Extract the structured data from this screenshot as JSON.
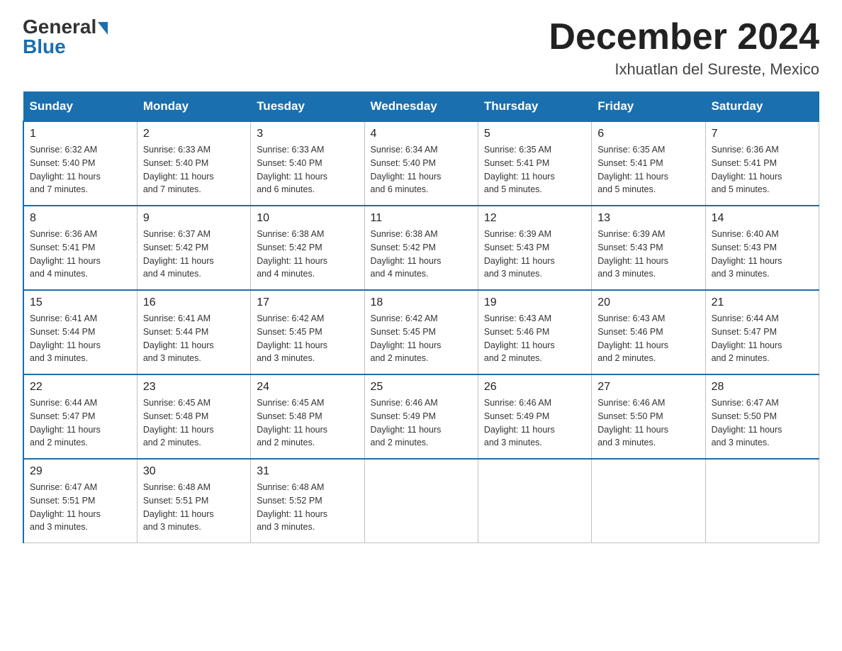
{
  "logo": {
    "general": "General",
    "blue": "Blue"
  },
  "header": {
    "title": "December 2024",
    "subtitle": "Ixhuatlan del Sureste, Mexico"
  },
  "days_of_week": [
    "Sunday",
    "Monday",
    "Tuesday",
    "Wednesday",
    "Thursday",
    "Friday",
    "Saturday"
  ],
  "weeks": [
    [
      {
        "day": "1",
        "sunrise": "6:32 AM",
        "sunset": "5:40 PM",
        "daylight": "11 hours and 7 minutes."
      },
      {
        "day": "2",
        "sunrise": "6:33 AM",
        "sunset": "5:40 PM",
        "daylight": "11 hours and 7 minutes."
      },
      {
        "day": "3",
        "sunrise": "6:33 AM",
        "sunset": "5:40 PM",
        "daylight": "11 hours and 6 minutes."
      },
      {
        "day": "4",
        "sunrise": "6:34 AM",
        "sunset": "5:40 PM",
        "daylight": "11 hours and 6 minutes."
      },
      {
        "day": "5",
        "sunrise": "6:35 AM",
        "sunset": "5:41 PM",
        "daylight": "11 hours and 5 minutes."
      },
      {
        "day": "6",
        "sunrise": "6:35 AM",
        "sunset": "5:41 PM",
        "daylight": "11 hours and 5 minutes."
      },
      {
        "day": "7",
        "sunrise": "6:36 AM",
        "sunset": "5:41 PM",
        "daylight": "11 hours and 5 minutes."
      }
    ],
    [
      {
        "day": "8",
        "sunrise": "6:36 AM",
        "sunset": "5:41 PM",
        "daylight": "11 hours and 4 minutes."
      },
      {
        "day": "9",
        "sunrise": "6:37 AM",
        "sunset": "5:42 PM",
        "daylight": "11 hours and 4 minutes."
      },
      {
        "day": "10",
        "sunrise": "6:38 AM",
        "sunset": "5:42 PM",
        "daylight": "11 hours and 4 minutes."
      },
      {
        "day": "11",
        "sunrise": "6:38 AM",
        "sunset": "5:42 PM",
        "daylight": "11 hours and 4 minutes."
      },
      {
        "day": "12",
        "sunrise": "6:39 AM",
        "sunset": "5:43 PM",
        "daylight": "11 hours and 3 minutes."
      },
      {
        "day": "13",
        "sunrise": "6:39 AM",
        "sunset": "5:43 PM",
        "daylight": "11 hours and 3 minutes."
      },
      {
        "day": "14",
        "sunrise": "6:40 AM",
        "sunset": "5:43 PM",
        "daylight": "11 hours and 3 minutes."
      }
    ],
    [
      {
        "day": "15",
        "sunrise": "6:41 AM",
        "sunset": "5:44 PM",
        "daylight": "11 hours and 3 minutes."
      },
      {
        "day": "16",
        "sunrise": "6:41 AM",
        "sunset": "5:44 PM",
        "daylight": "11 hours and 3 minutes."
      },
      {
        "day": "17",
        "sunrise": "6:42 AM",
        "sunset": "5:45 PM",
        "daylight": "11 hours and 3 minutes."
      },
      {
        "day": "18",
        "sunrise": "6:42 AM",
        "sunset": "5:45 PM",
        "daylight": "11 hours and 2 minutes."
      },
      {
        "day": "19",
        "sunrise": "6:43 AM",
        "sunset": "5:46 PM",
        "daylight": "11 hours and 2 minutes."
      },
      {
        "day": "20",
        "sunrise": "6:43 AM",
        "sunset": "5:46 PM",
        "daylight": "11 hours and 2 minutes."
      },
      {
        "day": "21",
        "sunrise": "6:44 AM",
        "sunset": "5:47 PM",
        "daylight": "11 hours and 2 minutes."
      }
    ],
    [
      {
        "day": "22",
        "sunrise": "6:44 AM",
        "sunset": "5:47 PM",
        "daylight": "11 hours and 2 minutes."
      },
      {
        "day": "23",
        "sunrise": "6:45 AM",
        "sunset": "5:48 PM",
        "daylight": "11 hours and 2 minutes."
      },
      {
        "day": "24",
        "sunrise": "6:45 AM",
        "sunset": "5:48 PM",
        "daylight": "11 hours and 2 minutes."
      },
      {
        "day": "25",
        "sunrise": "6:46 AM",
        "sunset": "5:49 PM",
        "daylight": "11 hours and 2 minutes."
      },
      {
        "day": "26",
        "sunrise": "6:46 AM",
        "sunset": "5:49 PM",
        "daylight": "11 hours and 3 minutes."
      },
      {
        "day": "27",
        "sunrise": "6:46 AM",
        "sunset": "5:50 PM",
        "daylight": "11 hours and 3 minutes."
      },
      {
        "day": "28",
        "sunrise": "6:47 AM",
        "sunset": "5:50 PM",
        "daylight": "11 hours and 3 minutes."
      }
    ],
    [
      {
        "day": "29",
        "sunrise": "6:47 AM",
        "sunset": "5:51 PM",
        "daylight": "11 hours and 3 minutes."
      },
      {
        "day": "30",
        "sunrise": "6:48 AM",
        "sunset": "5:51 PM",
        "daylight": "11 hours and 3 minutes."
      },
      {
        "day": "31",
        "sunrise": "6:48 AM",
        "sunset": "5:52 PM",
        "daylight": "11 hours and 3 minutes."
      },
      null,
      null,
      null,
      null
    ]
  ],
  "labels": {
    "sunrise": "Sunrise:",
    "sunset": "Sunset:",
    "daylight": "Daylight:"
  }
}
